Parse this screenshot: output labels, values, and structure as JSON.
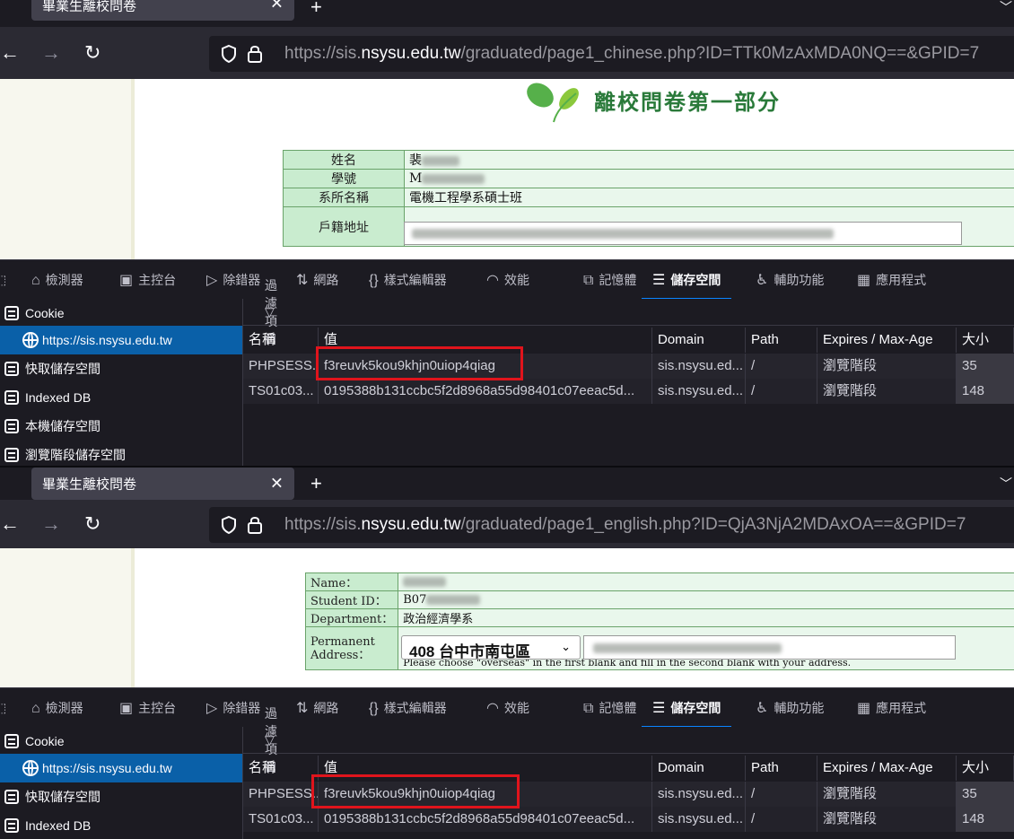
{
  "panels": [
    {
      "tab_title": "畢業生離校問卷",
      "url_prefix": "https://sis.",
      "url_domain": "nsysu.edu.tw",
      "url_path": "/graduated/page1_chinese.php?ID=TTk0MzAxMDA0NQ==&GPID=7",
      "page_heading": "離校問卷第一部分",
      "form": [
        {
          "label": "姓名",
          "value": "裴"
        },
        {
          "label": "學號",
          "value": "M"
        },
        {
          "label": "系所名稱",
          "value": "電機工程學系碩士班"
        },
        {
          "label": "戶籍地址",
          "value": ""
        }
      ],
      "sidebar": [
        {
          "label": "Cookie"
        },
        {
          "label": "https://sis.nsysu.edu.tw"
        },
        {
          "label": "快取儲存空間"
        },
        {
          "label": "Indexed DB"
        },
        {
          "label": "本機儲存空間"
        },
        {
          "label": "瀏覽階段儲存空間"
        }
      ]
    },
    {
      "tab_title": "畢業生離校問卷",
      "url_prefix": "https://sis.",
      "url_domain": "nsysu.edu.tw",
      "url_path": "/graduated/page1_english.php?ID=QjA3NjA2MDAxOA==&GPID=7",
      "form": [
        {
          "label": "Name：",
          "value": ""
        },
        {
          "label": "Student ID：",
          "value": "B07"
        },
        {
          "label": "Department：",
          "value": "政治經濟學系"
        },
        {
          "label": "Permanent Address：",
          "value": ""
        }
      ],
      "address_select": "408 台中市南屯區",
      "address_hint": "Please choose \"overseas\" in the first blank and fill in the second blank with your address.",
      "sidebar": [
        {
          "label": "Cookie"
        },
        {
          "label": "https://sis.nsysu.edu.tw"
        },
        {
          "label": "快取儲存空間"
        },
        {
          "label": "Indexed DB"
        }
      ]
    }
  ],
  "devtools_tabs": [
    "檢測器",
    "主控台",
    "除錯器",
    "網路",
    "樣式編輯器",
    "效能",
    "記憶體",
    "儲存空間",
    "輔助功能",
    "應用程式"
  ],
  "active_devtools_tab": "儲存空間",
  "filter_placeholder": "過濾項目",
  "columns": [
    "名稱",
    "值",
    "Domain",
    "Path",
    "Expires / Max-Age",
    "大小"
  ],
  "cookies": [
    {
      "name": "PHPSESS...",
      "value": "f3reuvk5kou9khjn0uiop4qiag",
      "domain": "sis.nsysu.ed...",
      "path": "/",
      "expires": "瀏覽階段",
      "size": "35"
    },
    {
      "name": "TS01c03...",
      "value": "0195388b131ccbc5f2d8968a55d98401c07eeac5d...",
      "domain": "sis.nsysu.ed...",
      "path": "/",
      "expires": "瀏覽階段",
      "size": "148"
    }
  ],
  "highlight_color": "#e0141c"
}
